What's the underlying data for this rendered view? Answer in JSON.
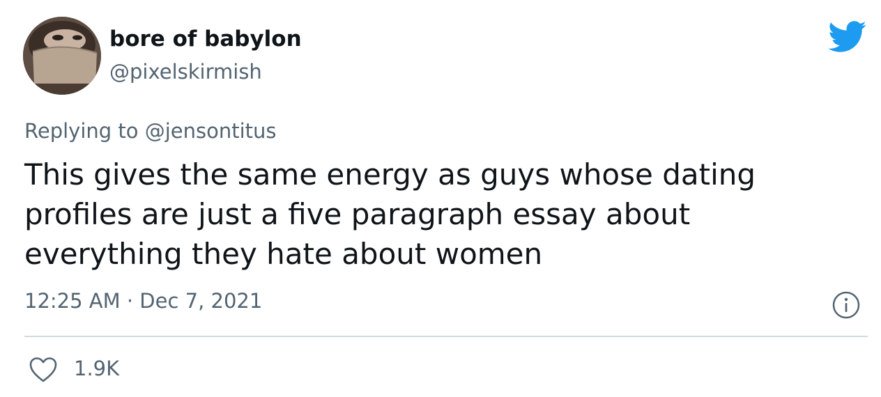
{
  "user": {
    "display_name": "bore of babylon",
    "handle": "@pixelskirmish",
    "avatar_icon": "avatar-masked-person"
  },
  "brand": {
    "logo_icon": "twitter-bird-icon",
    "accent_color": "#1d9bf0"
  },
  "reply": {
    "prefix": "Replying to",
    "mention": "@jensontitus"
  },
  "tweet": {
    "lines": [
      "This gives the same energy as guys whose dating",
      "profiles are just a five paragraph essay about",
      "everything they hate about women"
    ],
    "timestamp": "12:25 AM · Dec 7, 2021"
  },
  "actions": {
    "like_icon": "heart-icon",
    "like_count": "1.9K",
    "info_icon": "info-icon"
  },
  "colors": {
    "text_primary": "#0f1419",
    "text_secondary": "#536471",
    "divider": "#cfd9de"
  }
}
